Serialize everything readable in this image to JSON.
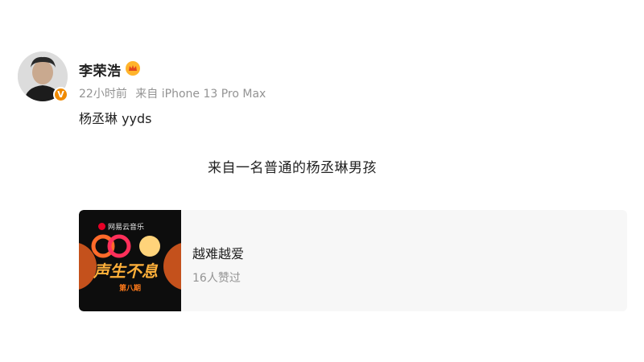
{
  "post": {
    "author": "李荣浩",
    "time": "22小时前",
    "source_prefix": "来自",
    "device": "iPhone 13 Pro Max",
    "text": "杨丞琳 yyds",
    "quote": "来自一名普通的杨丞琳男孩",
    "verified_mark": "V"
  },
  "music_card": {
    "title": "越难越爱",
    "likes": "16人赞过",
    "cover": {
      "brand": "网易云音乐",
      "show_title": "声生不息",
      "episode": "第八期"
    }
  },
  "colors": {
    "meta_gray": "#939393",
    "verified_orange": "#f08a00",
    "card_bg": "#f7f7f7",
    "cover_orange": "#ffb03a"
  }
}
